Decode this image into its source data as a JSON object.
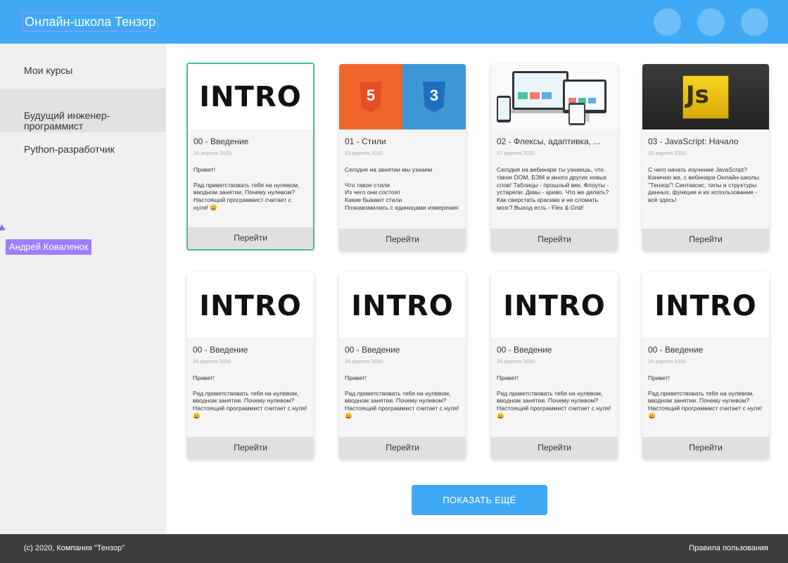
{
  "header": {
    "brand": "Онлайн-школа Тензор"
  },
  "sidebar": {
    "items": [
      {
        "label": "Мои курсы"
      },
      {
        "label": "Будущий инженер-\nпрограммист"
      },
      {
        "label": "Python-разработчик"
      }
    ]
  },
  "user": {
    "name": "Андрей Коваленок"
  },
  "cards": [
    {
      "title": "00 - Введение",
      "date": "20 апреля 2020",
      "desc": "Привет!\n\nРад приветствовать тебя на нулевом, вводном занятии. Почему нулевом? Настоящий программист считает с нуля! 😄",
      "button": "Перейти",
      "cover_text": "INTRO"
    },
    {
      "title": "01 - Стили",
      "date": "23 апреля 2020",
      "desc": "Сегодня на занятии мы узнаем\n\nЧто такое стили\nИз чего они состоят\nКакие бывают стили\nПознакомились с единицами измерения",
      "button": "Перейти",
      "cover_icons": [
        "html5-icon",
        "css3-icon"
      ]
    },
    {
      "title": "02 - Флексы, адаптивка, ...",
      "date": "27 апреля 2020",
      "desc": "Сегодня на вебинаре ты узнаешь, что такое DOM, БЭМ и много других новых слов! Таблицы - прошлый век. Флоуты - устарели. Дивы - криво. Что же делать? Как сверстать красиво и не сломать мозг? Выход есть - Flex & Grid!",
      "button": "Перейти",
      "cover_icons": [
        "responsive-devices-icon"
      ]
    },
    {
      "title": "03 - JavaScript: Начало",
      "date": "30 апреля 2020",
      "desc": "С чего начать изучение JavaScript? Конечно же, с вебинара Онлайн-школы \"Тензор\"! Синтаксис, типы и структуры данных, функции и их использование - всё здесь!",
      "button": "Перейти",
      "cover_text": "Js"
    },
    {
      "title": "00 - Введение",
      "date": "20 апреля 2020",
      "desc": "Привет!\n\nРад приветствовать тебя на нулевом, вводном занятии. Почему нулевом? Настоящий программист считает с нуля! 😄",
      "button": "Перейти",
      "cover_text": "INTRO"
    },
    {
      "title": "00 - Введение",
      "date": "20 апреля 2020",
      "desc": "Привет!\n\nРад приветствовать тебя на нулевом, вводном занятии. Почему нулевом? Настоящий программист считает с нуля! 😄",
      "button": "Перейти",
      "cover_text": "INTRO"
    },
    {
      "title": "00 - Введение",
      "date": "20 апреля 2020",
      "desc": "Привет!\n\nРад приветствовать тебя на нулевом, вводном занятии. Почему нулевом? Настоящий программист считает с нуля! 😄",
      "button": "Перейти",
      "cover_text": "INTRO"
    },
    {
      "title": "00 - Введение",
      "date": "20 апреля 2020",
      "desc": "Привет!\n\nРад приветствовать тебя на нулевом, вводном занятии. Почему нулевом? Настоящий программист считает с нуля! 😄",
      "button": "Перейти",
      "cover_text": "INTRO"
    }
  ],
  "more_button": "ПОКАЗАТЬ ЕЩЁ",
  "footer": {
    "copyright": "(с) 2020, Компания \"Тензор\"",
    "rules": "Правила пользования"
  },
  "colors": {
    "accent": "#3fa9f5",
    "selected_border": "#3cc383",
    "footer_bg": "#3d3d3d"
  }
}
